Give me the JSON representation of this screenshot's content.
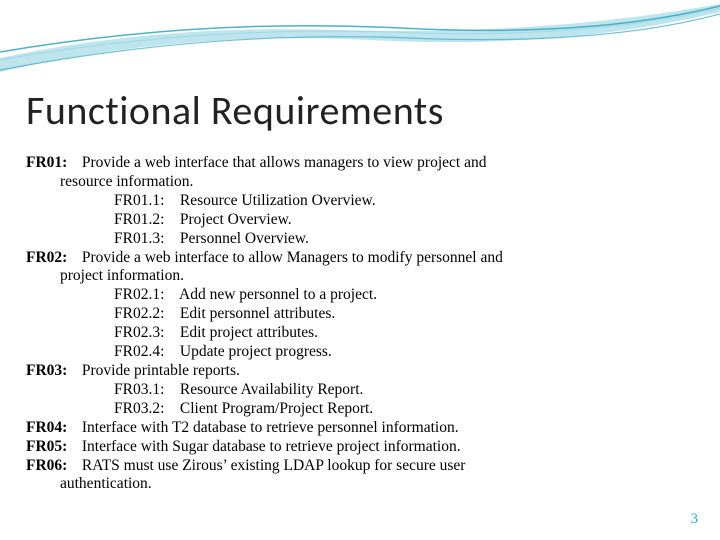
{
  "title": "Functional Requirements",
  "page_number": "3",
  "requirements": [
    {
      "id": "FR01:",
      "text": "Provide a web interface that allows managers to view project and",
      "continuation": "resource information.",
      "subs": [
        {
          "id": "FR01.1:",
          "text": "Resource Utilization Overview."
        },
        {
          "id": "FR01.2:",
          "text": "Project Overview."
        },
        {
          "id": "FR01.3:",
          "text": "Personnel Overview."
        }
      ]
    },
    {
      "id": "FR02:",
      "text": "Provide a web interface to allow Managers to modify personnel and",
      "continuation": "project information.",
      "subs": [
        {
          "id": "FR02.1:",
          "text": "Add new personnel to a project."
        },
        {
          "id": "FR02.2:",
          "text": "Edit personnel attributes."
        },
        {
          "id": "FR02.3:",
          "text": "Edit project attributes."
        },
        {
          "id": "FR02.4:",
          "text": "Update project progress."
        }
      ]
    },
    {
      "id": "FR03:",
      "text": "Provide printable reports.",
      "continuation": "",
      "subs": [
        {
          "id": "FR03.1:",
          "text": "Resource Availability Report."
        },
        {
          "id": "FR03.2:",
          "text": "Client Program/Project Report."
        }
      ]
    },
    {
      "id": "FR04:",
      "text": "Interface with T2 database to retrieve personnel information.",
      "continuation": "",
      "subs": []
    },
    {
      "id": "FR05:",
      "text": "Interface with Sugar database to retrieve project information.",
      "continuation": "",
      "subs": []
    },
    {
      "id": "FR06:",
      "text": "RATS must use Zirous’ existing LDAP lookup for secure user",
      "continuation": "authentication.",
      "subs": []
    }
  ]
}
